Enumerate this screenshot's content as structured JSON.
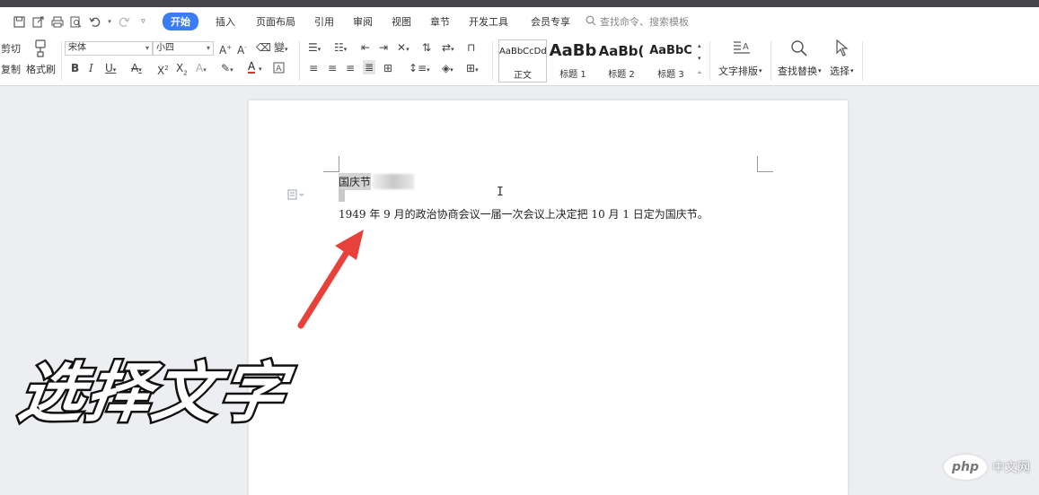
{
  "menu": {
    "tabs": [
      "开始",
      "插入",
      "页面布局",
      "引用",
      "审阅",
      "视图",
      "章节",
      "开发工具",
      "会员专享"
    ],
    "search_placeholder": "查找命令、搜索模板"
  },
  "ribbon": {
    "cut": "剪切",
    "copy": "复制",
    "format_painter": "格式刷",
    "font_name": "宋体",
    "font_size": "小四",
    "styles": [
      {
        "preview": "AaBbCcDd",
        "label": "正文"
      },
      {
        "preview": "AaBb",
        "label": "标题 1"
      },
      {
        "preview": "AaBb(",
        "label": "标题 2"
      },
      {
        "preview": "AaBbC",
        "label": "标题 3"
      }
    ],
    "text_layout": "文字排版",
    "find_replace": "查找替换",
    "select": "选择"
  },
  "document": {
    "line1": "国庆节",
    "line2": "1949 年 9 月的政治协商会议一届一次会议上决定把 10 月 1 日定为国庆节。"
  },
  "caption": "选择文字",
  "watermark": {
    "logo": "php",
    "text": "中文网"
  },
  "colors": {
    "accent": "#3a7bf6",
    "arrow": "#e8413c"
  }
}
